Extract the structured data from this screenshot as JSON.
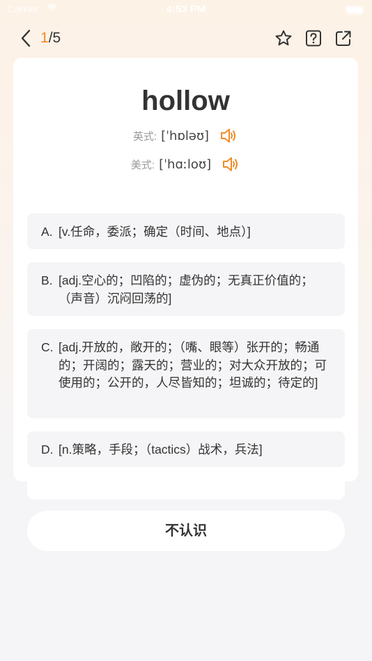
{
  "status": {
    "carrier": "Carrier",
    "time": "4:53 PM"
  },
  "nav": {
    "current": "1",
    "total": "/5"
  },
  "word": "hollow",
  "pronunciations": [
    {
      "label": "英式:",
      "text": "[ˈhɒləʊ]"
    },
    {
      "label": "美式:",
      "text": "[ˈhɑːloʊ]"
    }
  ],
  "options": [
    {
      "letter": "A.",
      "definition": "[v.任命，委派；确定（时间、地点）]"
    },
    {
      "letter": "B.",
      "definition": "[adj.空心的；凹陷的；虚伪的；无真正价值的；（声音）沉闷回荡的]"
    },
    {
      "letter": "C.",
      "definition": "[adj.开放的，敞开的；（嘴、眼等）张开的；畅通的；开阔的；露天的；营业的；对大众开放的；可使用的；公开的，人尽皆知的；坦诚的；待定的]"
    },
    {
      "letter": "D.",
      "definition": "[n.策略，手段；（tactics）战术，兵法]"
    }
  ],
  "unknown_label": "不认识",
  "colors": {
    "accent": "#f08a24",
    "card": "#ffffff",
    "option_bg": "#f5f5f7"
  },
  "icons": [
    "back-chevron-icon",
    "star-icon",
    "help-icon",
    "share-icon",
    "speaker-icon"
  ]
}
